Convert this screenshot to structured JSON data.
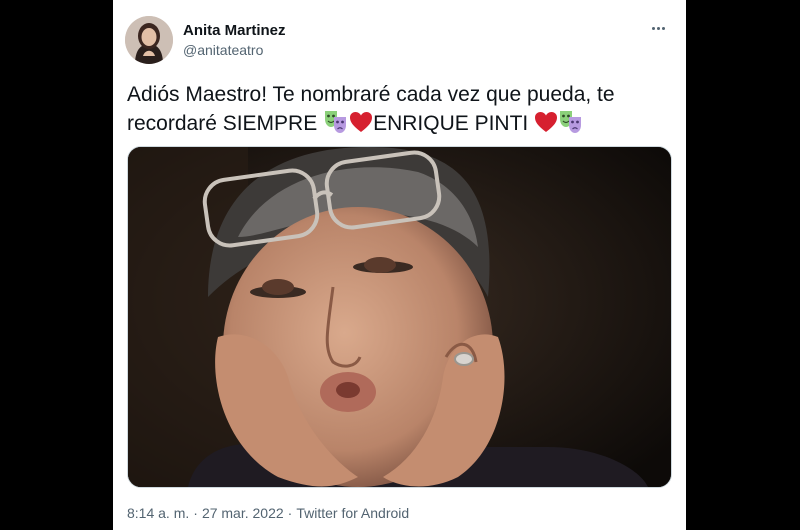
{
  "author": {
    "display_name": "Anita Martinez",
    "handle": "@anitateatro"
  },
  "tweet": {
    "text_part1": "Adiós Maestro! Te nombraré cada vez que pueda, te recordaré SIEMPRE ",
    "text_part2": "ENRIQUE PINTI ",
    "emojis": [
      "performing-arts-icon",
      "red-heart-icon",
      "red-heart-icon",
      "performing-arts-icon"
    ]
  },
  "meta": {
    "time": "8:14 a. m.",
    "date": "27 mar. 2022",
    "separator": "·",
    "source": "Twitter for Android"
  },
  "colors": {
    "text": "#0f1419",
    "secondary": "#536471",
    "heart": "#d6202f",
    "mask_green": "#8bd07a",
    "mask_purple": "#b79ae0"
  }
}
